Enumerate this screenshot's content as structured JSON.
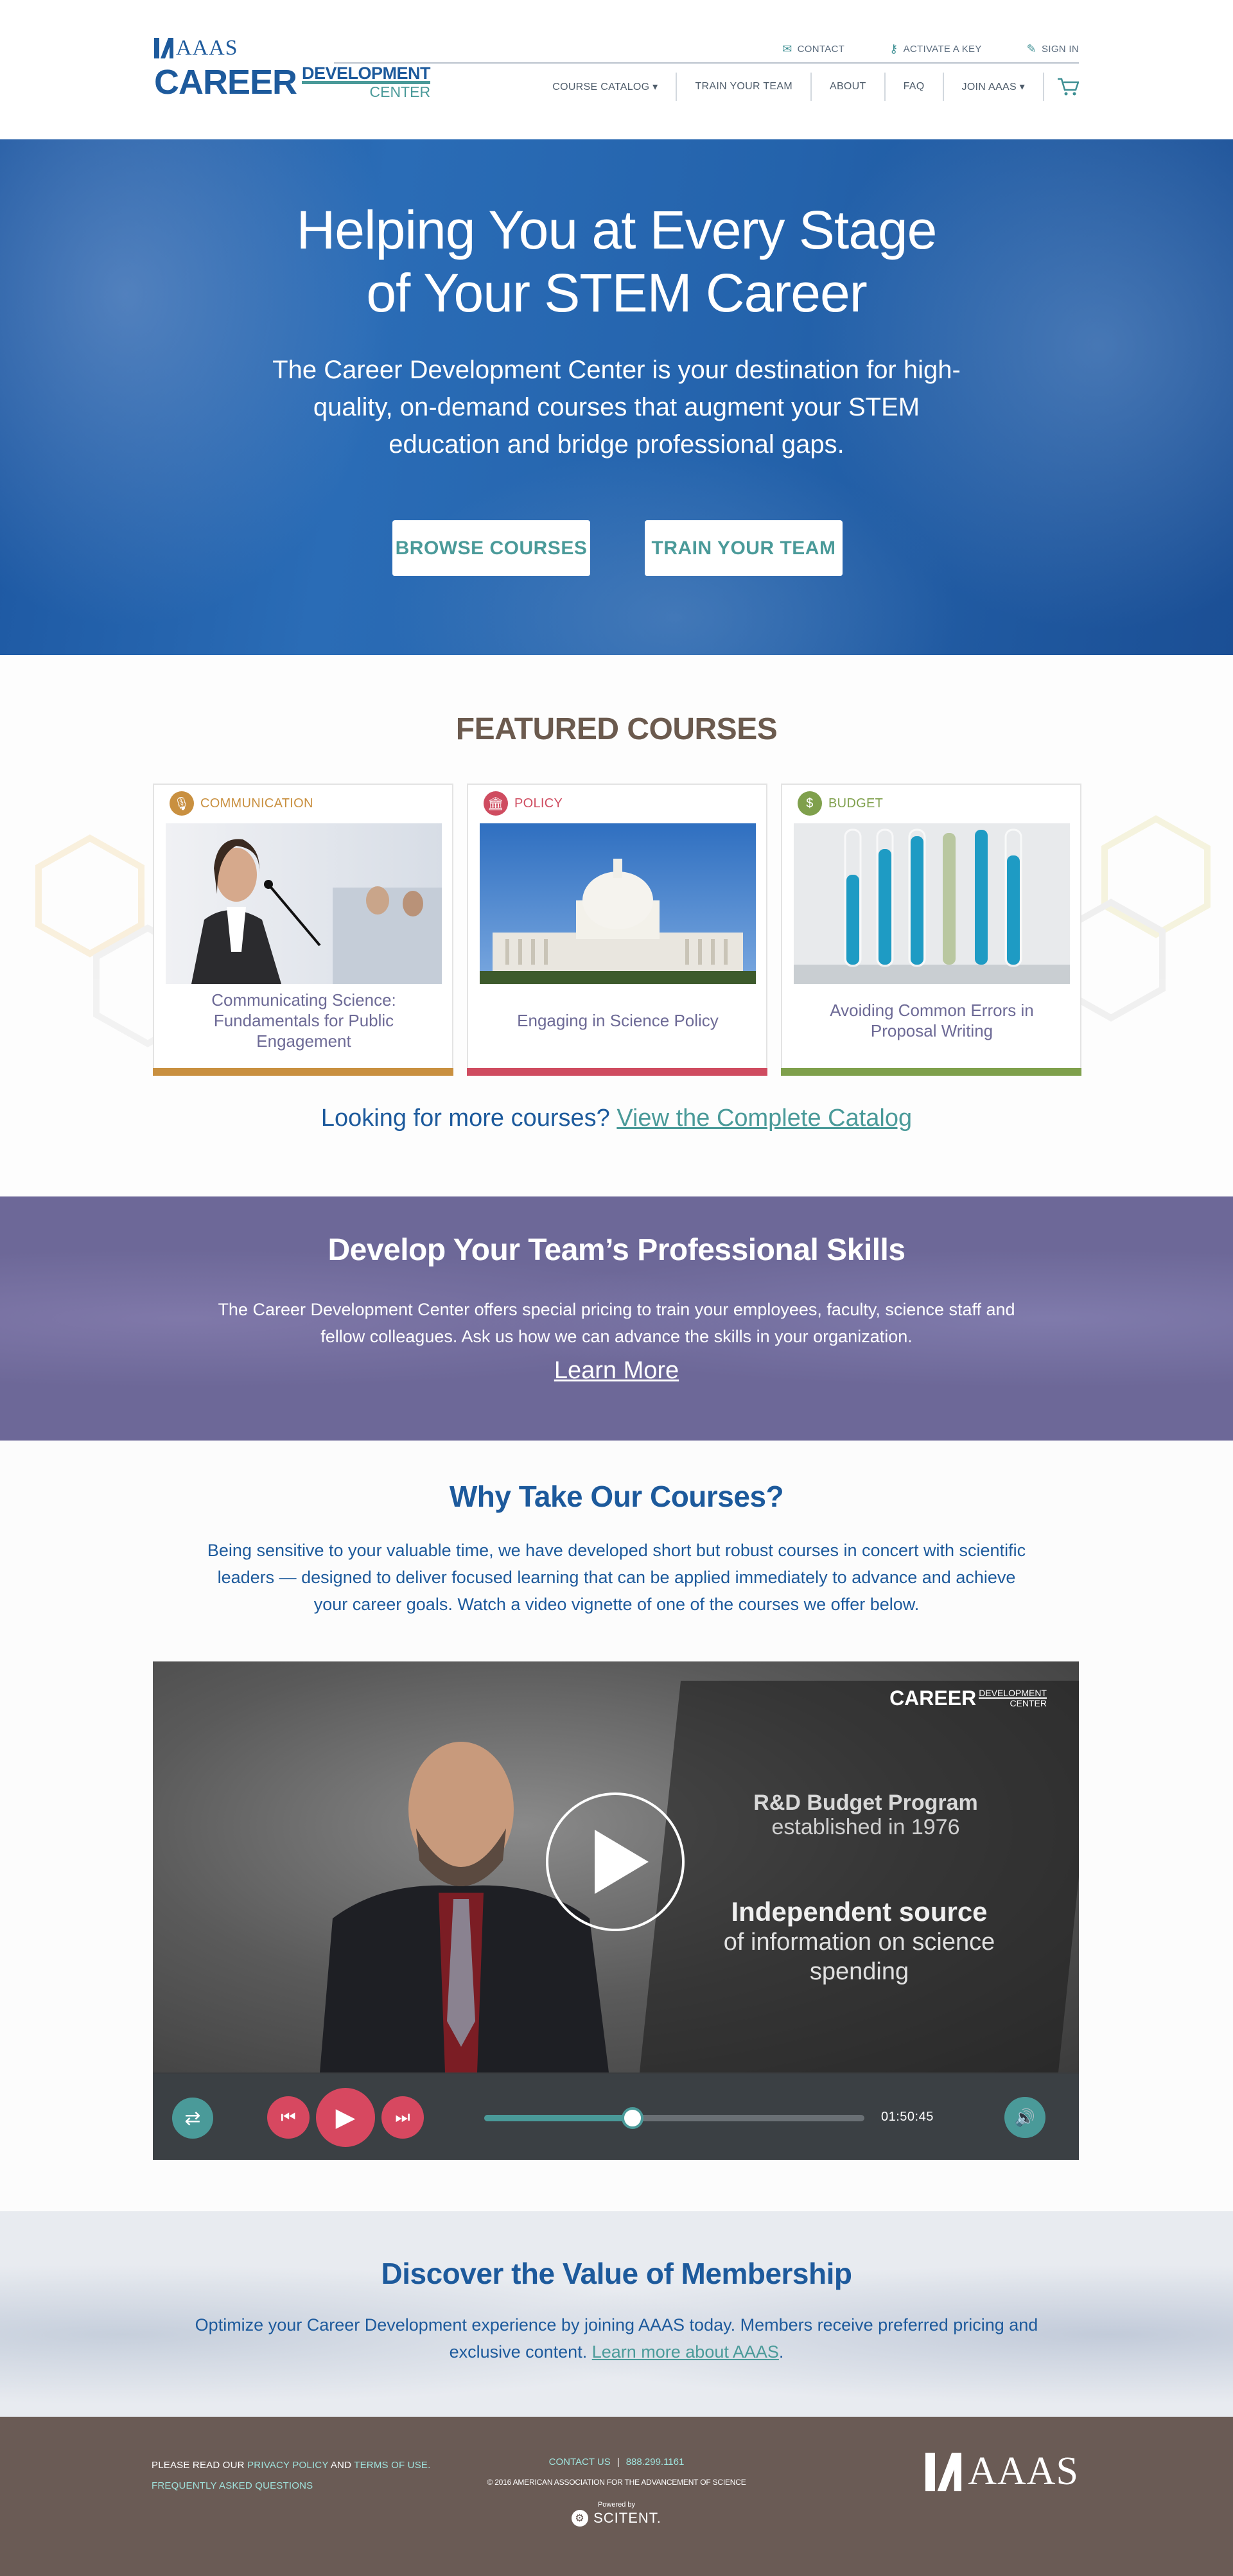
{
  "header": {
    "logo_aaas": "AAAS",
    "logo_career": "CAREER",
    "logo_development": "DEVELOPMENT",
    "logo_center": "CENTER",
    "utility": {
      "contact": "CONTACT",
      "activate": "ACTIVATE A KEY",
      "signin": "SIGN IN"
    },
    "nav": {
      "catalog": "COURSE CATALOG ▾",
      "train": "TRAIN YOUR TEAM",
      "about": "ABOUT",
      "faq": "FAQ",
      "join": "JOIN AAAS ▾"
    }
  },
  "hero": {
    "title_line1": "Helping You at Every Stage",
    "title_line2": "of Your STEM Career",
    "text": "The Career Development Center is your destination for high-quality, on-demand courses that augment your STEM education and bridge professional gaps.",
    "browse_label": "BROWSE COURSES",
    "train_label": "TRAIN YOUR TEAM"
  },
  "featured": {
    "heading": "FEATURED COURSES",
    "cards": [
      {
        "category": "COMMUNICATION",
        "title": "Communicating Science: Fundamentals for Public Engagement",
        "color": "#c99040"
      },
      {
        "category": "POLICY",
        "title": "Engaging in Science Policy",
        "color": "#cf4c60"
      },
      {
        "category": "BUDGET",
        "title": "Avoiding Common Errors in Proposal Writing",
        "color": "#7fa04c"
      }
    ],
    "more_text": "Looking for more courses?",
    "more_link": "View the Complete Catalog"
  },
  "team": {
    "heading": "Develop Your Team’s Professional Skills",
    "text": "The Career Development Center offers special pricing to train your employees, faculty, science staff and fellow colleagues. Ask us how we can advance the skills in your organization.",
    "learn_more": "Learn More"
  },
  "why": {
    "heading": "Why Take Our Courses?",
    "text": "Being sensitive to your valuable time, we have developed short but robust courses in concert with scientific leaders — designed to deliver focused learning that can be applied immediately to advance and achieve your career goals. Watch a video vignette of one of the courses we offer below."
  },
  "video": {
    "logo_career": "CAREER",
    "logo_development": "DEVELOPMENT",
    "logo_center": "CENTER",
    "overlay1": "R&D Budget Program",
    "overlay2": "established in 1976",
    "overlay3": "Independent source",
    "overlay4": "of information on science spending",
    "time": "01:50:45",
    "progress": 0.39
  },
  "membership": {
    "heading": "Discover the Value of Membership",
    "text": "Optimize your Career Development experience by joining AAAS today. Members receive preferred pricing and exclusive content.",
    "link": "Learn more about AAAS"
  },
  "footer": {
    "please_read": "PLEASE READ OUR",
    "privacy": "PRIVACY POLICY",
    "and": "AND",
    "terms": "TERMS OF USE.",
    "faq": "FREQUENTLY ASKED QUESTIONS",
    "contact": "CONTACT US",
    "phone": "888.299.1161",
    "copyright": "© 2016 AMERICAN ASSOCIATION FOR THE ADVANCEMENT OF SCIENCE",
    "powered": "Powered by",
    "scitent": "SCITENT.",
    "aaas": "AAAS"
  }
}
